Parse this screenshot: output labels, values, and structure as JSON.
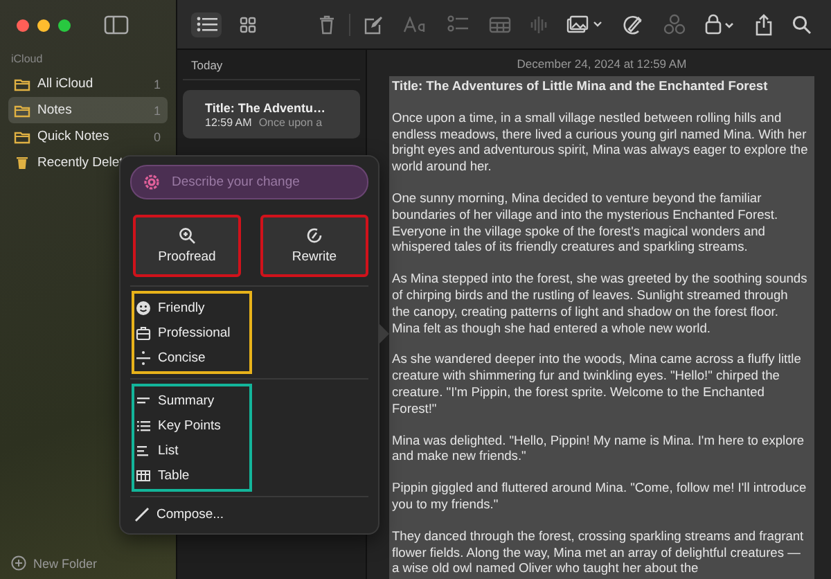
{
  "sidebar": {
    "section": "iCloud",
    "folders": [
      {
        "name": "All iCloud",
        "count": "1",
        "selected": false,
        "kind": "folder"
      },
      {
        "name": "Notes",
        "count": "1",
        "selected": true,
        "kind": "folder"
      },
      {
        "name": "Quick Notes",
        "count": "0",
        "selected": false,
        "kind": "folder"
      },
      {
        "name": "Recently Delet",
        "selected": false,
        "kind": "trash"
      }
    ],
    "new_folder": "New Folder"
  },
  "toolbar": {
    "views": [
      {
        "selected": true
      },
      {
        "selected": false
      }
    ]
  },
  "note_list": {
    "group": "Today",
    "notes": [
      {
        "title": "Title: The Adventu…",
        "time": "12:59 AM",
        "preview": "Once upon a",
        "selected": true
      }
    ]
  },
  "editor": {
    "date": "December 24, 2024 at 12:59 AM",
    "title": "Title: The Adventures of Little Mina and the Enchanted Forest",
    "selected": true,
    "paragraphs": [
      "Once upon a time, in a small village nestled between rolling hills and endless meadows, there lived a curious young girl named Mina. With her bright eyes and adventurous spirit, Mina was always eager to explore the world around her.",
      "One sunny morning, Mina decided to venture beyond the familiar boundaries of her village and into the mysterious Enchanted Forest. Everyone in the village spoke of the forest's magical wonders and whispered tales of its friendly creatures and sparkling streams.",
      "As Mina stepped into the forest, she was greeted by the soothing sounds of chirping birds and the rustling of leaves. Sunlight streamed through the canopy, creating patterns of light and shadow on the forest floor. Mina felt as though she had entered a whole new world.",
      "As she wandered deeper into the woods, Mina came across a fluffy little creature with shimmering fur and twinkling eyes. \"Hello!\" chirped the creature. \"I'm Pippin, the forest sprite. Welcome to the Enchanted Forest!\"",
      "Mina was delighted. \"Hello, Pippin! My name is Mina. I'm here to explore and make new friends.\"",
      "Pippin giggled and fluttered around Mina. \"Come, follow me! I'll introduce you to my friends.\"",
      "They danced through the forest, crossing sparkling streams and fragrant flower fields. Along the way, Mina met an array of delightful creatures — a wise old owl named Oliver who taught her about the"
    ]
  },
  "writing_tools": {
    "placeholder": "Describe your change",
    "actions": [
      {
        "label": "Proofread",
        "color": "#d0121b"
      },
      {
        "label": "Rewrite",
        "color": "#d0121b"
      }
    ],
    "groups": [
      {
        "color": "#e8b21a",
        "items": [
          "Friendly",
          "Professional",
          "Concise"
        ]
      },
      {
        "color": "#13b59a",
        "items": [
          "Summary",
          "Key Points",
          "List",
          "Table"
        ]
      }
    ],
    "compose": "Compose..."
  }
}
